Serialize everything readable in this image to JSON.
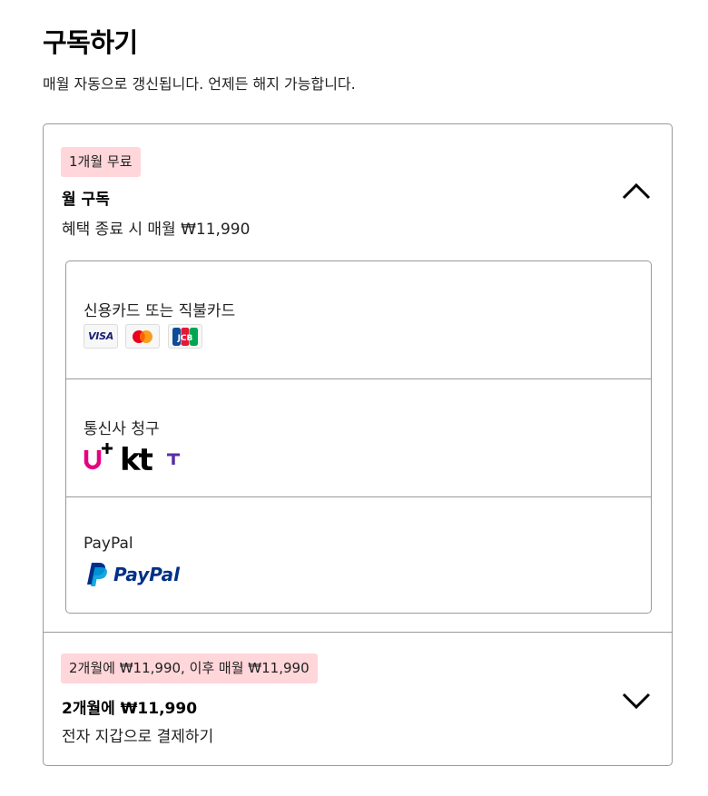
{
  "header": {
    "title": "구독하기",
    "subtitle": "매월 자동으로 갱신됩니다. 언제든 해지 가능합니다."
  },
  "plans": [
    {
      "badge": "1개월 무료",
      "name": "월 구독",
      "description": "혜택 종료 시 매월 ₩11,990",
      "expanded": true,
      "payment_methods": [
        {
          "label": "신용카드 또는 직불카드",
          "icons": [
            "visa-icon",
            "mastercard-icon",
            "jcb-icon"
          ]
        },
        {
          "label": "통신사 청구",
          "icons": [
            "lg-uplus-icon",
            "kt-icon",
            "skt-icon"
          ]
        },
        {
          "label": "PayPal",
          "icons": [
            "paypal-icon"
          ]
        }
      ]
    },
    {
      "badge": "2개월에 ₩11,990, 이후 매월 ₩11,990",
      "name": "2개월에 ₩11,990",
      "description": "전자 지갑으로 결제하기",
      "expanded": false
    }
  ],
  "logos": {
    "visa": "VISA",
    "jcb": "JCB",
    "kt": "kt",
    "paypal": "PayPal"
  },
  "colors": {
    "badge_bg": "#ffd6da",
    "border": "#999999",
    "uplus_magenta": "#e6007e",
    "skt_purple": "#5a2ea6",
    "paypal_dark": "#003087",
    "paypal_light": "#009cde"
  }
}
